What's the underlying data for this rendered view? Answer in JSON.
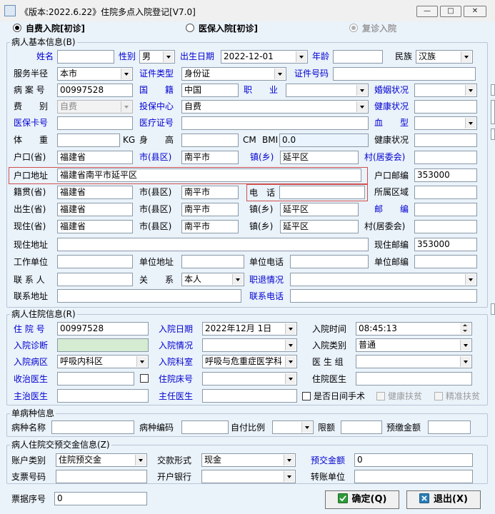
{
  "window": {
    "title": "《版本:2022.6.22》住院多点入院登记[V7.0]",
    "buttons": {
      "minimize": "—",
      "maximize": "□",
      "close": "✕"
    }
  },
  "admission_type": {
    "self_pay": "自费入院[初诊]",
    "insurance": "医保入院[初诊]",
    "revisit": "复诊入院",
    "selected": "self_pay"
  },
  "patient_info": {
    "group_title": "病人基本信息(B)",
    "name_label": "姓名",
    "name": "",
    "sex_label": "性别",
    "sex": "男",
    "birth_label": "出生日期",
    "birth": "2022-12-01",
    "age_label": "年龄",
    "age": "",
    "ethnic_label": "民族",
    "ethnic": "汉族",
    "radius_label": "服务半径",
    "radius": "本市",
    "idtype_label": "证件类型",
    "idtype": "身份证",
    "idno_label": "证件号码",
    "idno": "",
    "caseno_label": "病 案 号",
    "caseno": "00997528",
    "nation_label": "国　　籍",
    "nation": "中国",
    "job_label": "职　　业",
    "job": "",
    "marital_label": "婚姻状况",
    "marital": "",
    "fee_label": "费　　别",
    "fee": "自费",
    "center_label": "投保中心",
    "center": "自费",
    "health_label": "健康状况",
    "health": "",
    "cardno_label": "医保卡号",
    "cardno": "",
    "medno_label": "医疗证号",
    "medno": "",
    "blood_label": "血　　型",
    "blood": "",
    "weight_label": "体　　重",
    "weight": "",
    "weight_unit": "KG",
    "height_label": "身　　高",
    "height": "",
    "height_unit": "CM",
    "bmi_label": "BMI",
    "bmi": "0.0",
    "health2_label": "健康状况",
    "health2": "",
    "hukou_prov_label": "户口(省)",
    "hukou_prov": "福建省",
    "hukou_city_label": "市(县区)",
    "hukou_city": "南平市",
    "hukou_town_label": "镇(乡)",
    "hukou_town": "延平区",
    "hukou_village_label": "村(居委会)",
    "hukou_village": "",
    "hukou_addr_label": "户口地址",
    "hukou_addr": "福建省南平市延平区",
    "hukou_zip_label": "户口邮编",
    "hukou_zip": "353000",
    "native_prov_label": "籍贯(省)",
    "native_prov": "福建省",
    "native_city_label": "市(县区)",
    "native_city": "南平市",
    "phone_label": "电　话",
    "phone": "",
    "area_label": "所属区域",
    "area": "",
    "birth_prov_label": "出生(省)",
    "birth_prov": "福建省",
    "birth_city_label": "市(县区)",
    "birth_city": "南平市",
    "birth_town_label": "镇(乡)",
    "birth_town": "延平区",
    "zip_label": "邮　　编",
    "zip": "",
    "cur_prov_label": "现住(省)",
    "cur_prov": "福建省",
    "cur_city_label": "市(县区)",
    "cur_city": "南平市",
    "cur_town_label": "镇(乡)",
    "cur_town": "延平区",
    "cur_village_label": "村(居委会)",
    "cur_village": "",
    "cur_addr_label": "现住地址",
    "cur_addr": "",
    "cur_zip_label": "现住邮编",
    "cur_zip": "353000",
    "work_label": "工作单位",
    "work": "",
    "work_addr_label": "单位地址",
    "work_addr": "",
    "work_phone_label": "单位电话",
    "work_phone": "",
    "work_zip_label": "单位邮编",
    "work_zip": "",
    "contact_label": "联 系 人",
    "contact": "",
    "relation_label": "关　　系",
    "relation": "本人",
    "retire_label": "职退情况",
    "retire": "",
    "contact_addr_label": "联系地址",
    "contact_addr": "",
    "contact_phone_label": "联系电话",
    "contact_phone": ""
  },
  "admission_info": {
    "group_title": "病人住院信息(R)",
    "inpno_label": "住 院 号",
    "inpno": "00997528",
    "date_label": "入院日期",
    "date": "2022年12月 1日",
    "time_label": "入院时间",
    "time": "08:45:13",
    "diag_label": "入院诊断",
    "diag": "",
    "cond_label": "入院情况",
    "cond": "",
    "category_label": "入院类别",
    "category": "普通",
    "ward_label": "入院病区",
    "ward": "呼吸内科区",
    "dept_label": "入院科室",
    "dept": "呼吸与危重症医学科",
    "team_label": "医 生 组",
    "team": "",
    "doctor_label": "收治医生",
    "doctor": "",
    "bed_label": "住院床号",
    "bed": "",
    "inp_doctor_label": "住院医生",
    "inp_doctor": "",
    "attending_label": "主治医生",
    "attending": "",
    "chief_label": "主任医生",
    "chief": "",
    "daysurg_label": "是否日间手术",
    "poverty_label": "健康扶贫",
    "precise_label": "精准扶贫"
  },
  "disease": {
    "group_title": "单病种信息",
    "name_label": "病种名称",
    "name": "",
    "code_label": "病种编码",
    "code": "",
    "ratio_label": "自付比例",
    "ratio": "",
    "limit_label": "限额",
    "limit": "",
    "prepay_label": "预缴金额",
    "prepay": ""
  },
  "deposit": {
    "group_title": "病人住院交预交金信息(Z)",
    "acct_type_label": "账户类别",
    "acct_type": "住院预交金",
    "pay_form_label": "交款形式",
    "pay_form": "现金",
    "amount_label": "预交金额",
    "amount": "0",
    "check_no_label": "支票号码",
    "check_no": "",
    "bank_label": "开户银行",
    "bank": "",
    "transfer_label": "转账单位",
    "transfer": ""
  },
  "footer": {
    "receipt_label": "票据序号",
    "receipt": "0",
    "ok_button": "确定(Q)",
    "exit_button": "退出(X)"
  },
  "colors": {
    "accent_label": "#0000d0",
    "field_green": "#d6ecd2",
    "highlight_red": "#d05050",
    "background": "#eaf2fa"
  }
}
